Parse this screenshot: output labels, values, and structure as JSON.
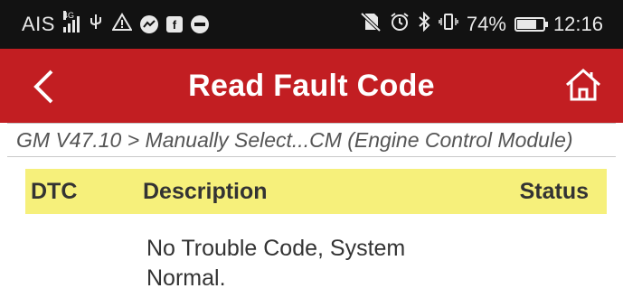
{
  "status_bar": {
    "carrier": "AIS",
    "network": "4G",
    "battery_percent": "74%",
    "battery_level": 0.74,
    "time": "12:16",
    "icons": [
      "signal-icon",
      "usb-icon",
      "warning-icon",
      "messenger-icon",
      "facebook-icon",
      "line-icon",
      "no-sim-icon",
      "alarm-icon",
      "bluetooth-icon",
      "vibrate-icon",
      "battery-icon"
    ]
  },
  "app_bar": {
    "title": "Read Fault Code",
    "back_icon": "chevron-left-icon",
    "home_icon": "home-icon"
  },
  "breadcrumb": "GM V47.10 > Manually Select...CM (Engine Control Module)",
  "table": {
    "headers": {
      "dtc": "DTC",
      "description": "Description",
      "status": "Status"
    },
    "rows": [
      {
        "dtc": "",
        "description": "No Trouble Code, System Normal.",
        "status": ""
      }
    ]
  },
  "colors": {
    "app_bar": "#c21e22",
    "header_row": "#f6f07b",
    "status_bar": "#121212"
  }
}
